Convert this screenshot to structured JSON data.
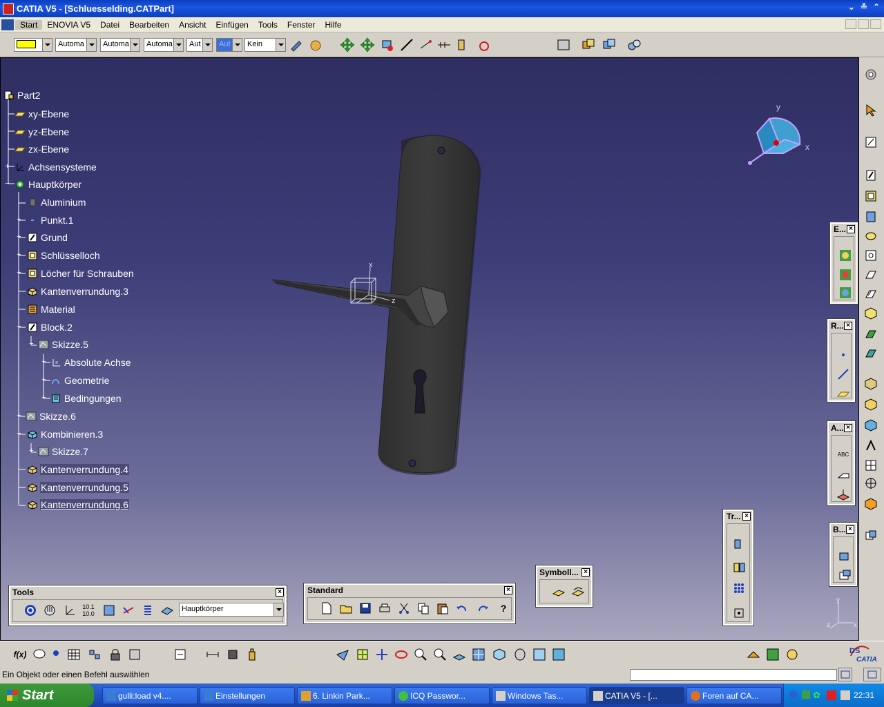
{
  "window": {
    "title": "CATIA V5 - [Schluesselding.CATPart]"
  },
  "menu": [
    "Start",
    "ENOVIA V5",
    "Datei",
    "Bearbeiten",
    "Ansicht",
    "Einfügen",
    "Tools",
    "Fenster",
    "Hilfe"
  ],
  "toolbar": {
    "color_value": "",
    "combos": [
      "Automa",
      "Automa",
      "Automa",
      "Aut",
      "Aut",
      "Kein"
    ]
  },
  "tree": {
    "items": [
      {
        "label": "Part2"
      },
      {
        "label": "xy-Ebene"
      },
      {
        "label": "yz-Ebene"
      },
      {
        "label": "zx-Ebene"
      },
      {
        "label": "Achsensysteme"
      },
      {
        "label": "Hauptkörper"
      },
      {
        "label": "Aluminium"
      },
      {
        "label": "Punkt.1"
      },
      {
        "label": "Grund"
      },
      {
        "label": "Schlüsselloch"
      },
      {
        "label": "Löcher für Schrauben"
      },
      {
        "label": "Kantenverrundung.3"
      },
      {
        "label": "Material"
      },
      {
        "label": "Block.2"
      },
      {
        "label": "Skizze.5"
      },
      {
        "label": "Absolute Achse"
      },
      {
        "label": "Geometrie"
      },
      {
        "label": "Bedingungen"
      },
      {
        "label": "Skizze.6"
      },
      {
        "label": "Kombinieren.3"
      },
      {
        "label": "Skizze.7"
      },
      {
        "label": "Kantenverrundung.4"
      },
      {
        "label": "Kantenverrundung.5"
      },
      {
        "label": "Kantenverrundung.6"
      }
    ]
  },
  "compass": {
    "x_label": "x",
    "y_label": "y",
    "z_label": "z"
  },
  "axis_triad": {
    "x": "x",
    "y": "y",
    "z": "z"
  },
  "panels": {
    "tools": {
      "title": "Tools",
      "body_combo": "Hauptkörper"
    },
    "standard": {
      "title": "Standard"
    },
    "symbol": {
      "title": "Symboll..."
    },
    "tr": {
      "title": "Tr..."
    },
    "e": {
      "title": "E..."
    },
    "r": {
      "title": "R..."
    },
    "a": {
      "title": "A..."
    },
    "b": {
      "title": "B..."
    }
  },
  "status": {
    "message": "Ein Objekt oder einen Befehl auswählen",
    "command_value": ""
  },
  "taskbar": {
    "start": "Start",
    "tasks": [
      "gulli:load v4....",
      "Einstellungen",
      "6. Linkin Park...",
      "ICQ Passwor...",
      "Windows Tas...",
      "CATIA V5 - [...",
      "Foren auf CA..."
    ],
    "clock": "22:31"
  },
  "brand": "CATIA",
  "colors": {
    "viewport_top": "#2f2e62",
    "viewport_bottom": "#a9a7be",
    "tree_text": "#ffffff",
    "part_color": "#3a3a3a"
  }
}
